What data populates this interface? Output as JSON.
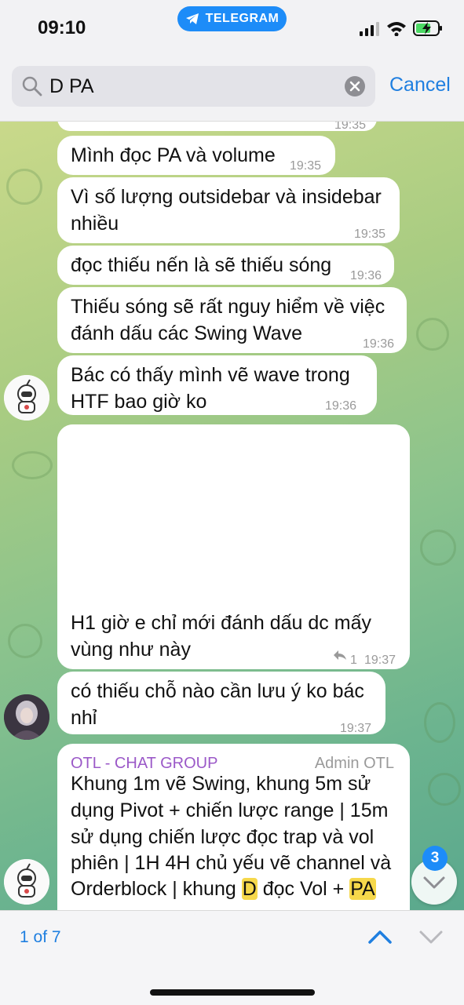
{
  "status_bar": {
    "time": "09:10",
    "app_pill": "TELEGRAM"
  },
  "search": {
    "value": "D PA",
    "cancel_label": "Cancel"
  },
  "messages": [
    {
      "text": "",
      "time": "19:35"
    },
    {
      "text": "Mình đọc PA và volume",
      "time": "19:35"
    },
    {
      "text_line1": "Vì số lượng outsidebar và insidebar",
      "text_line2": "nhiều",
      "time": "19:35"
    },
    {
      "text": "đọc thiếu nến là sẽ thiếu sóng",
      "time": "19:36"
    },
    {
      "text_line1": "Thiếu sóng sẽ rất nguy hiểm về việc",
      "text_line2": "đánh dấu các Swing Wave",
      "time": "19:36"
    },
    {
      "text_line1": "Bác có thấy mình vẽ wave trong",
      "text_line2": "HTF bao giờ ko",
      "time": "19:36"
    },
    {
      "text_line1": "H1 giờ e chỉ mới đánh dấu dc mấy",
      "text_line2": "vùng như này",
      "reply_count": "1",
      "time": "19:37"
    },
    {
      "text_line1": "có thiếu chỗ nào cần lưu ý ko bác",
      "text_line2": "nhỉ",
      "time": "19:37"
    }
  ],
  "group_message": {
    "sender": "OTL - CHAT GROUP",
    "role": "Admin OTL",
    "line1": "Khung 1m vẽ Swing, khung 5m sử",
    "line2": "dụng Pivot + chiến lược range | 15m",
    "line3": "sử dụng chiến lược đọc trap và vol",
    "line4": "phiên | 1H 4H chủ yếu vẽ channel và",
    "line5_a": "Orderblock | khung ",
    "line5_hl1": "D",
    "line5_b": " đọc Vol + ",
    "line5_hl2": "PA"
  },
  "unread_badge": "3",
  "bottom_bar": {
    "counter": "1 of 7"
  },
  "colors": {
    "accent": "#1f7fe0",
    "highlight": "#f6d84b",
    "pill": "#1d8cf8"
  }
}
